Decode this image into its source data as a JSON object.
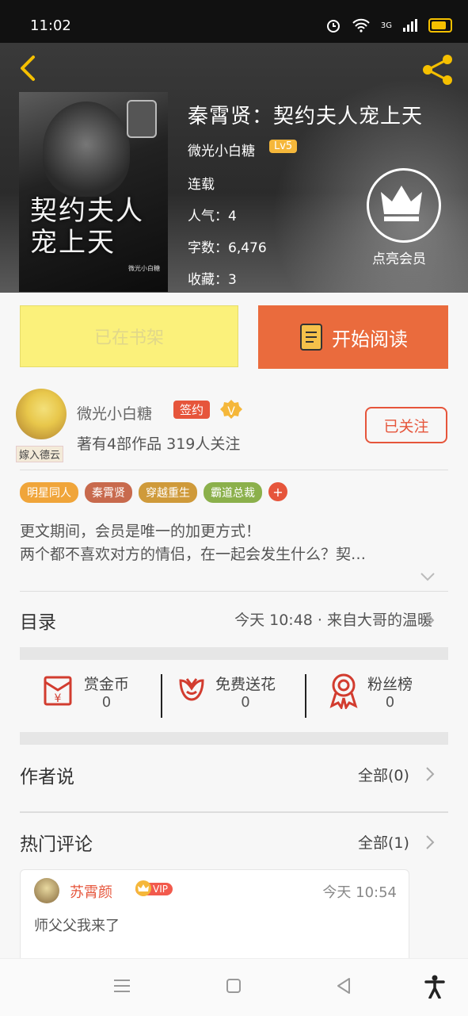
{
  "status_bar": {
    "time": "11:02",
    "network": "3G"
  },
  "book": {
    "title": "秦霄贤：契约夫人宠上天",
    "author": "微光小白糖",
    "level": "Lv5",
    "status": "连载",
    "popularity": "人气：4",
    "word_count": "字数：6,476",
    "favorites": "收藏：3",
    "member_label": "点亮会员",
    "cover_title": "契约夫人宠上天",
    "cover_author": "微光小白糖"
  },
  "actions": {
    "shelf_label": "已在书架",
    "read_label": "开始阅读"
  },
  "author_card": {
    "avatar_tag": "嫁入德云",
    "name": "微光小白糖",
    "signed_label": "签约",
    "v_badge": "V",
    "stats": "著有4部作品 319人关注",
    "follow_label": "已关注"
  },
  "tags": [
    {
      "label": "明星同人",
      "color": "#f0a53a"
    },
    {
      "label": "秦霄贤",
      "color": "#c86a4d"
    },
    {
      "label": "穿越重生",
      "color": "#cf9a3a"
    },
    {
      "label": "霸道总裁",
      "color": "#8bb04b"
    }
  ],
  "tag_more": "+",
  "description": {
    "line1": "更文期间，会员是唯一的加更方式！",
    "line2": "两个都不喜欢对方的情侣，在一起会发生什么？契…"
  },
  "toc": {
    "label": "目录",
    "latest": "今天 10:48 · 来自大哥的温暖"
  },
  "stats": [
    {
      "label": "赏金币",
      "value": "0",
      "icon": "coin-envelope-icon"
    },
    {
      "label": "免费送花",
      "value": "0",
      "icon": "flower-icon"
    },
    {
      "label": "粉丝榜",
      "value": "0",
      "icon": "medal-icon"
    }
  ],
  "author_says": {
    "title": "作者说",
    "all": "全部(0)"
  },
  "hot_comments": {
    "title": "热门评论",
    "all": "全部(1)"
  },
  "comment": {
    "user": "苏霄颜",
    "vip": "VIP",
    "time": "今天 10:54",
    "text": "师父父我来了"
  },
  "colors": {
    "accent": "#ea6b3d",
    "shelf": "#fbf17b",
    "red": "#e6553b"
  }
}
